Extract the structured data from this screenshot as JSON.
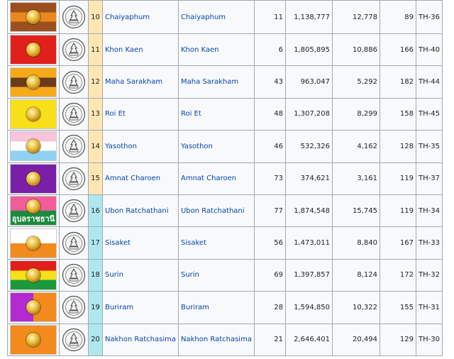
{
  "colors": {
    "region_upper": "#ffe6b3",
    "region_lower": "#aee8ee",
    "link": "#0645ad",
    "border": "#a2a9b1"
  },
  "rows": [
    {
      "rank": "10",
      "name": "Chaiyaphum",
      "name_alt": "Chaiyaphum",
      "col_a": "11",
      "population": "1,138,777",
      "area": "12,778",
      "density": "89",
      "iso": "TH-36",
      "region": "upper",
      "flag": {
        "icon": "chaiyaphum-flag-icon",
        "stripes": [
          "#9b4f1e",
          "#e8891e",
          "#9b4f1e"
        ],
        "layout": "h"
      }
    },
    {
      "rank": "11",
      "name": "Khon Kaen",
      "name_alt": "Khon Kaen",
      "col_a": "6",
      "population": "1,805,895",
      "area": "10,886",
      "density": "166",
      "iso": "TH-40",
      "region": "upper",
      "flag": {
        "icon": "khon-kaen-flag-icon",
        "stripes": [
          "#e0201b"
        ],
        "layout": "h"
      }
    },
    {
      "rank": "12",
      "name": "Maha Sarakham",
      "name_alt": "Maha Sarakham",
      "col_a": "43",
      "population": "963,047",
      "area": "5,292",
      "density": "182",
      "iso": "TH-44",
      "region": "upper",
      "flag": {
        "icon": "maha-sarakham-flag-icon",
        "stripes": [
          "#f6a91a",
          "#6b3b1c",
          "#f6a91a"
        ],
        "layout": "h"
      }
    },
    {
      "rank": "13",
      "name": "Roi Et",
      "name_alt": "Roi Et",
      "col_a": "48",
      "population": "1,307,208",
      "area": "8,299",
      "density": "158",
      "iso": "TH-45",
      "region": "upper",
      "flag": {
        "icon": "roi-et-flag-icon",
        "stripes": [
          "#f7e01a"
        ],
        "layout": "h"
      }
    },
    {
      "rank": "14",
      "name": "Yasothon",
      "name_alt": "Yasothon",
      "col_a": "46",
      "population": "532,326",
      "area": "4,162",
      "density": "128",
      "iso": "TH-35",
      "region": "upper",
      "flag": {
        "icon": "yasothon-flag-icon",
        "stripes": [
          "#f7c4dc",
          "#ffffff",
          "#8fd1ee"
        ],
        "layout": "h"
      }
    },
    {
      "rank": "15",
      "name": "Amnat Charoen",
      "name_alt": "Amnat Charoen",
      "col_a": "73",
      "population": "374,621",
      "area": "3,161",
      "density": "119",
      "iso": "TH-37",
      "region": "upper",
      "flag": {
        "icon": "amnat-charoen-flag-icon",
        "stripes": [
          "#7a1fa8"
        ],
        "layout": "h"
      }
    },
    {
      "rank": "16",
      "name": "Ubon Ratchathani",
      "name_alt": "Ubon Ratchathani",
      "col_a": "77",
      "population": "1,874,548",
      "area": "15,745",
      "density": "119",
      "iso": "TH-34",
      "region": "lower",
      "flag": {
        "icon": "ubon-ratchathani-flag-icon",
        "stripes": [
          "#f05d9a",
          "#1b8a3c"
        ],
        "layout": "h",
        "script": "อุบลราชธานี"
      }
    },
    {
      "rank": "17",
      "name": "Sisaket",
      "name_alt": "Sisaket",
      "col_a": "56",
      "population": "1,473,011",
      "area": "8,840",
      "density": "167",
      "iso": "TH-33",
      "region": "lower",
      "flag": {
        "icon": "sisaket-flag-icon",
        "stripes": [
          "#ffffff",
          "#f38a1e"
        ],
        "layout": "h"
      }
    },
    {
      "rank": "18",
      "name": "Surin",
      "name_alt": "Surin",
      "col_a": "69",
      "population": "1,397,857",
      "area": "8,124",
      "density": "172",
      "iso": "TH-32",
      "region": "lower",
      "flag": {
        "icon": "surin-flag-icon",
        "stripes": [
          "#e0201b",
          "#f7e01a",
          "#1b9a3c"
        ],
        "layout": "h"
      }
    },
    {
      "rank": "19",
      "name": "Buriram",
      "name_alt": "Buriram",
      "col_a": "28",
      "population": "1,594,850",
      "area": "10,322",
      "density": "155",
      "iso": "TH-31",
      "region": "lower",
      "flag": {
        "icon": "buriram-flag-icon",
        "stripes": [
          "#b32bd0",
          "#f38a1e"
        ],
        "layout": "v"
      }
    },
    {
      "rank": "20",
      "name": "Nakhon Ratchasima",
      "name_alt": "Nakhon Ratchasima",
      "col_a": "21",
      "population": "2,646,401",
      "area": "20,494",
      "density": "129",
      "iso": "TH-30",
      "region": "lower",
      "flag": {
        "icon": "nakhon-ratchasima-flag-icon",
        "stripes": [
          "#f38a1e"
        ],
        "layout": "h"
      }
    }
  ]
}
